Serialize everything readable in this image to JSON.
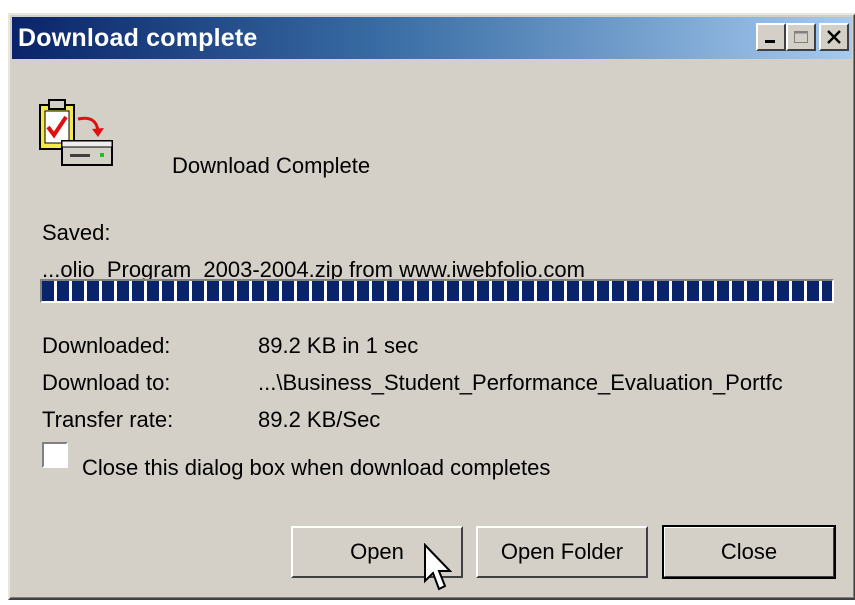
{
  "window": {
    "title": "Download complete"
  },
  "titlebar_buttons": {
    "minimize": "minimize-icon",
    "maximize": "maximize-icon",
    "close": "close-icon"
  },
  "content": {
    "heading": "Download Complete",
    "saved_label": "Saved:",
    "saved_file": "...olio_Program_2003-2004.zip from www.iwebfolio.com",
    "progress_percent": 100,
    "downloaded_label": "Downloaded:",
    "downloaded_value": "89.2 KB in 1 sec",
    "download_to_label": "Download to:",
    "download_to_value": "...\\Business_Student_Performance_Evaluation_Portfc",
    "transfer_rate_label": "Transfer rate:",
    "transfer_rate_value": "89.2 KB/Sec",
    "close_checkbox_label": "Close this dialog box when download completes",
    "close_checkbox_checked": false
  },
  "buttons": {
    "open": "Open",
    "open_folder": "Open Folder",
    "close": "Close"
  },
  "colors": {
    "titlebar_start": "#0a246a",
    "titlebar_end": "#a6caf0",
    "progress": "#0a246a",
    "face": "#d4d0c8"
  }
}
